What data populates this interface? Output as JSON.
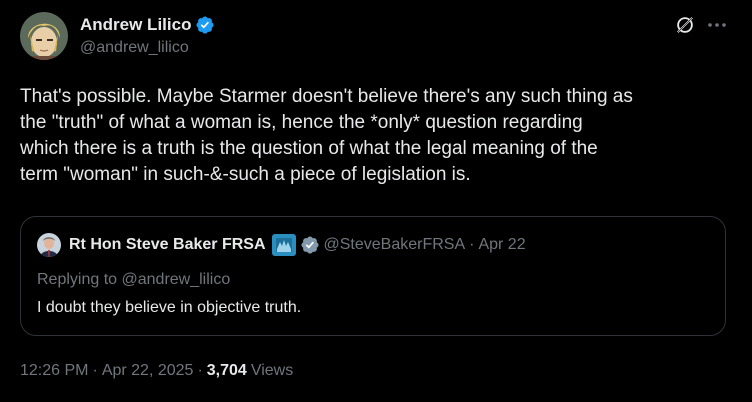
{
  "author": {
    "display_name": "Andrew Lilico",
    "handle": "@andrew_lilico",
    "verified": true,
    "verified_color": "#1d9bf0"
  },
  "tweet": {
    "text": "That's possible. Maybe Starmer doesn't believe there's any such thing as\nthe \"truth\" of what a woman is, hence the *only* question regarding\nwhich there is a truth is the question of what the legal meaning of the\nterm \"woman\" in such-&-such a piece of legislation is."
  },
  "quote": {
    "display_name": "Rt Hon Steve Baker FRSA",
    "handle": "@SteveBakerFRSA",
    "separator": "·",
    "date": "Apr 22",
    "replying_prefix": "Replying to",
    "replying_to": "@andrew_lilico",
    "text": "I doubt they believe in objective truth.",
    "verified_badge_color": "#829aab"
  },
  "meta": {
    "time": "12:26 PM",
    "dot1": "·",
    "date": "Apr 22, 2025",
    "dot2": "·",
    "views_count": "3,704",
    "views_label": "Views"
  },
  "icons": {
    "grok": "grok-icon",
    "more": "more-icon",
    "verified": "verified-badge-icon"
  }
}
